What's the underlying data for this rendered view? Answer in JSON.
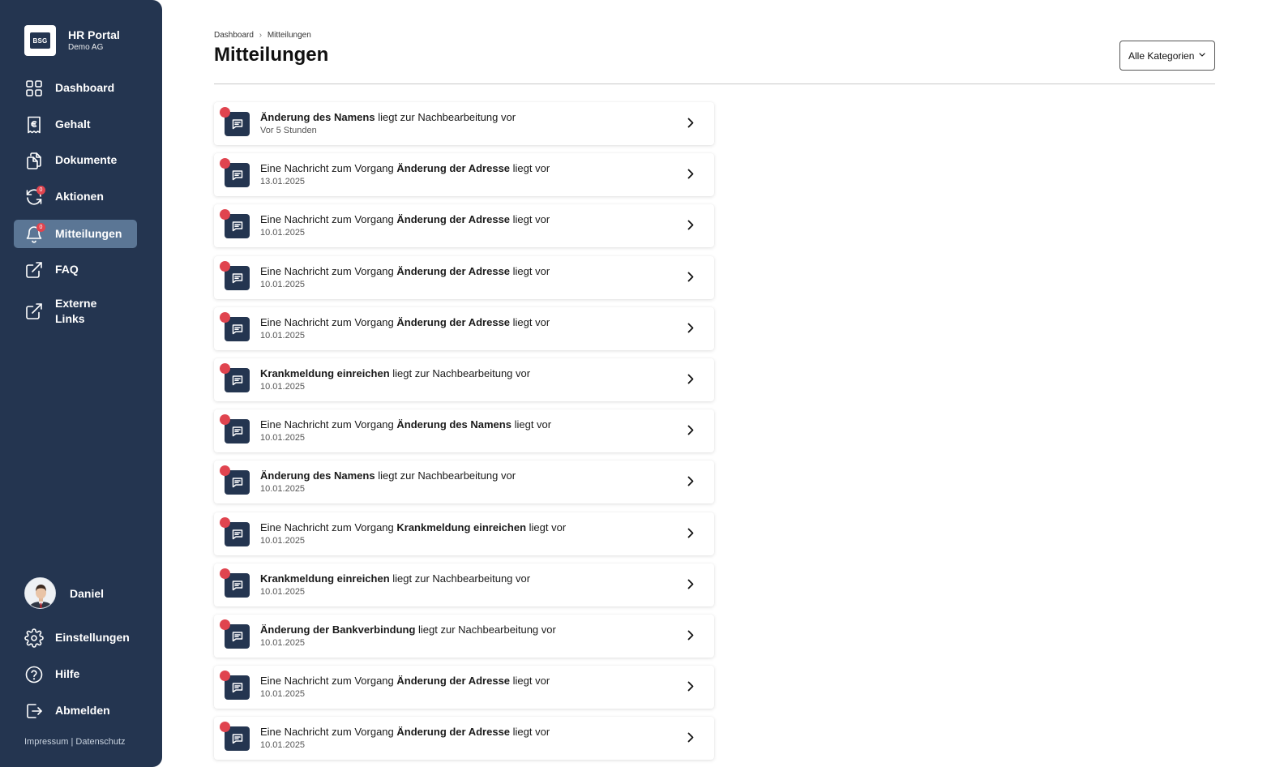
{
  "app": {
    "logo_text": "BSG",
    "title": "HR Portal",
    "subtitle": "Demo AG"
  },
  "nav": {
    "items": [
      {
        "label": "Dashboard",
        "icon": "grid-icon"
      },
      {
        "label": "Gehalt",
        "icon": "receipt-euro-icon"
      },
      {
        "label": "Dokumente",
        "icon": "documents-icon"
      },
      {
        "label": "Aktionen",
        "icon": "refresh-icon",
        "badge": "0"
      },
      {
        "label": "Mitteilungen",
        "icon": "bell-icon",
        "badge": "0",
        "active": true
      },
      {
        "label": "FAQ",
        "icon": "external-link-icon"
      },
      {
        "label": "Externe Links",
        "icon": "external-link-icon"
      }
    ],
    "user": {
      "name": "Daniel"
    },
    "bottom_items": [
      {
        "label": "Einstellungen",
        "icon": "gear-icon"
      },
      {
        "label": "Hilfe",
        "icon": "help-icon"
      },
      {
        "label": "Abmelden",
        "icon": "logout-icon"
      }
    ],
    "footer": {
      "impressum": "Impressum",
      "separator": "|",
      "datenschutz": "Datenschutz"
    }
  },
  "header": {
    "breadcrumb": [
      "Dashboard",
      "Mitteilungen"
    ],
    "breadcrumb_separator": "›",
    "title": "Mitteilungen",
    "filter_label": "Alle Kategorien"
  },
  "colors": {
    "sidebar": "#243550",
    "active": "#5b7695",
    "unread": "#e0444f"
  },
  "notifications": [
    {
      "pre": "",
      "bold": "Änderung des Namens",
      "post": " liegt zur Nachbearbeitung vor",
      "date": "Vor 5 Stunden"
    },
    {
      "pre": "Eine Nachricht zum Vorgang ",
      "bold": "Änderung der Adresse",
      "post": " liegt vor",
      "date": "13.01.2025"
    },
    {
      "pre": "Eine Nachricht zum Vorgang ",
      "bold": "Änderung der Adresse",
      "post": " liegt vor",
      "date": "10.01.2025"
    },
    {
      "pre": "Eine Nachricht zum Vorgang ",
      "bold": "Änderung der Adresse",
      "post": " liegt vor",
      "date": "10.01.2025"
    },
    {
      "pre": "Eine Nachricht zum Vorgang ",
      "bold": "Änderung der Adresse",
      "post": " liegt vor",
      "date": "10.01.2025"
    },
    {
      "pre": "",
      "bold": "Krankmeldung einreichen",
      "post": " liegt zur Nachbearbeitung vor",
      "date": "10.01.2025"
    },
    {
      "pre": "Eine Nachricht zum Vorgang ",
      "bold": "Änderung des Namens",
      "post": " liegt vor",
      "date": "10.01.2025"
    },
    {
      "pre": "",
      "bold": "Änderung des Namens",
      "post": " liegt zur Nachbearbeitung vor",
      "date": "10.01.2025"
    },
    {
      "pre": "Eine Nachricht zum Vorgang ",
      "bold": "Krankmeldung einreichen",
      "post": " liegt vor",
      "date": "10.01.2025"
    },
    {
      "pre": "",
      "bold": "Krankmeldung einreichen",
      "post": " liegt zur Nachbearbeitung vor",
      "date": "10.01.2025"
    },
    {
      "pre": "",
      "bold": "Änderung der Bankverbindung",
      "post": " liegt zur Nachbearbeitung vor",
      "date": "10.01.2025"
    },
    {
      "pre": "Eine Nachricht zum Vorgang ",
      "bold": "Änderung der Adresse",
      "post": " liegt vor",
      "date": "10.01.2025"
    },
    {
      "pre": "Eine Nachricht zum Vorgang ",
      "bold": "Änderung der Adresse",
      "post": " liegt vor",
      "date": "10.01.2025"
    }
  ]
}
